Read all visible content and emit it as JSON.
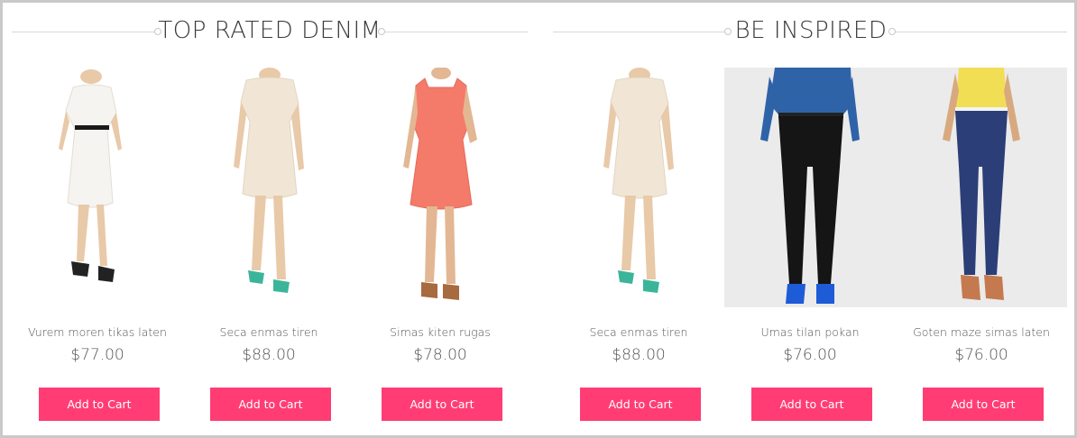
{
  "sections": [
    {
      "title": "TOP RATED DENIM",
      "products": [
        {
          "name": "Vurem moren tikas laten",
          "price": "$77.00",
          "button": "Add to Cart",
          "image_icon": "white-lace-dress-back"
        },
        {
          "name": "Seca enmas tiren",
          "price": "$88.00",
          "button": "Add to Cart",
          "image_icon": "cream-lace-dress-back"
        },
        {
          "name": "Simas kiten rugas",
          "price": "$78.00",
          "button": "Add to Cart",
          "image_icon": "coral-lace-dress"
        }
      ]
    },
    {
      "title": "BE INSPIRED",
      "products": [
        {
          "name": "Seca enmas tiren",
          "price": "$88.00",
          "button": "Add to Cart",
          "image_icon": "cream-lace-dress-back"
        },
        {
          "name": "Umas tilan pokan",
          "price": "$76.00",
          "button": "Add to Cart",
          "image_icon": "black-jeans-blue-shirt"
        },
        {
          "name": "Goten maze simas laten",
          "price": "$76.00",
          "button": "Add to Cart",
          "image_icon": "blue-jeans-yellow-top"
        }
      ]
    }
  ],
  "colors": {
    "accent": "#ff3d74",
    "heading_text": "#3a3a3a",
    "rule": "#d8d8d8",
    "frame_border": "#c9c9c9"
  }
}
